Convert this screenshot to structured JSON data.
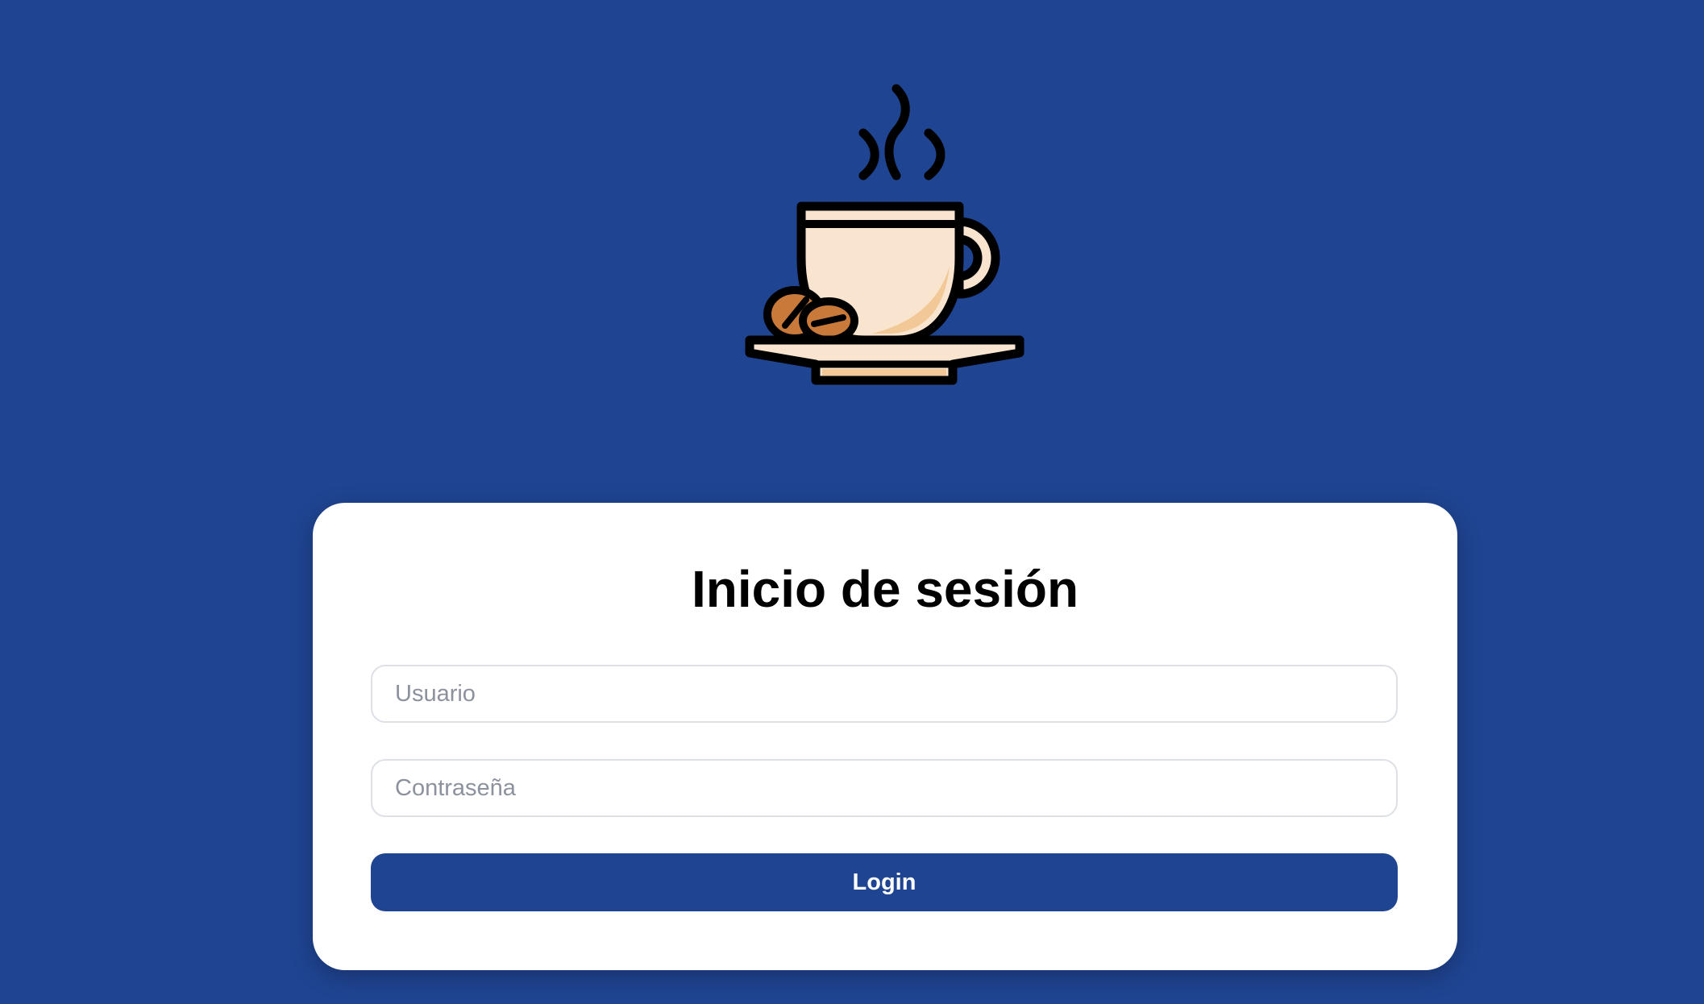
{
  "logo": {
    "icon": "coffee-cup-icon",
    "colors": {
      "outline": "#000000",
      "cup": "#f9e5cf",
      "cup_shadow": "#f2c896",
      "bean": "#c97a3a",
      "bean_dark": "#a35e27"
    }
  },
  "login": {
    "title": "Inicio de sesión",
    "username_placeholder": "Usuario",
    "username_value": "",
    "password_placeholder": "Contraseña",
    "password_value": "",
    "submit_label": "Login"
  },
  "colors": {
    "background": "#1f4491",
    "card": "#ffffff",
    "button": "#1f4491",
    "button_text": "#ffffff",
    "input_border": "#dde0e5",
    "placeholder": "#8c929d"
  }
}
